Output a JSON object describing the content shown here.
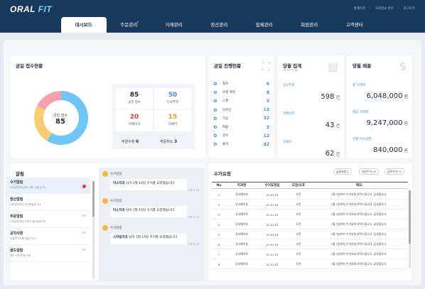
{
  "header": {
    "logo_a": "ORAL ",
    "logo_b": "FIT",
    "links": [
      "홈페이지",
      "|",
      "치과정보 관리",
      "|",
      "로그아웃"
    ],
    "tabs": [
      {
        "label": "대시보드",
        "active": true
      },
      {
        "label": "주문관리",
        "active": false,
        "dot": true
      },
      {
        "label": "자재관리"
      },
      {
        "label": "정산관리"
      },
      {
        "label": "업체관리"
      },
      {
        "label": "회원관리"
      },
      {
        "label": "고객센터"
      }
    ]
  },
  "status": {
    "title": "금일 접수현황",
    "center_label": "금일 접수",
    "center_value": "85",
    "donut": [
      {
        "value": 50,
        "color": "#6fc6f7"
      },
      {
        "value": 20,
        "color": "#f7cd6f"
      },
      {
        "value": 15,
        "color": "#f7a0b0"
      }
    ],
    "stats": [
      {
        "num": "85",
        "label": "금일 접수",
        "color": "#1e2d3d"
      },
      {
        "num": "50",
        "label": "신규주문",
        "color": "#3a8ee6"
      },
      {
        "num": "20",
        "label": "리메이크",
        "color": "#e33b3b"
      },
      {
        "num": "15",
        "label": "리페어",
        "color": "#f09a1f"
      }
    ],
    "order_edit_label": "주문수정",
    "order_edit_value": "6",
    "order_cancel_label": "주문취소",
    "order_cancel_value": "3"
  },
  "progress": {
    "title": "금일 진행현황",
    "items": [
      {
        "name": "접수",
        "value": "6"
      },
      {
        "name": "모델 제작",
        "value": "8"
      },
      {
        "name": "스캔",
        "value": "3"
      },
      {
        "name": "디자인",
        "value": "12"
      },
      {
        "name": "가공",
        "value": "32"
      },
      {
        "name": "작업",
        "value": "3"
      },
      {
        "name": "검수",
        "value": "12"
      },
      {
        "name": "출하",
        "value": "32"
      }
    ]
  },
  "settle": {
    "title": "당월 집계",
    "sub": "(총 675건 중)",
    "rows": [
      {
        "label": "신규주문",
        "value": "598",
        "unit": "건"
      },
      {
        "label": "리메이크",
        "value": "43",
        "unit": "건"
      },
      {
        "label": "리페어",
        "value": "62",
        "unit": "건"
      }
    ]
  },
  "sales": {
    "title": "당월 매출",
    "rows": [
      {
        "label": "총 거래액",
        "value": "6,048,000",
        "unit": "원"
      },
      {
        "label": "평균 거래액",
        "value": "9,247,000",
        "unit": "원"
      },
      {
        "label": "전월 미수금액",
        "value": "840,000",
        "unit": "원"
      }
    ]
  },
  "alarm": {
    "title": "알림",
    "items": [
      {
        "title": "수거알림",
        "sub": "스마일치과님께서 1월 14일 수거...",
        "time": "",
        "badge": true,
        "selected": true
      },
      {
        "title": "정산알림",
        "sub": "스마일치과님 정산예정입니다.",
        "time": ""
      },
      {
        "title": "주문알림",
        "sub": "스마일치과님 주문이 들어왔습니다.",
        "time": "오후"
      },
      {
        "title": "공지사항",
        "sub": "오랄핏 시스템 점검 안내",
        "time": "오후"
      },
      {
        "title": "골드알림",
        "sub": "골드 시세 변동 안내",
        "time": "오후"
      }
    ],
    "chats": [
      {
        "who": "수거알림",
        "name": "미소치과",
        "text": " 님이 1월 14일 수거를 요청했습니다.",
        "time": "오후 3:24"
      },
      {
        "who": "수거알림",
        "name": "미소치과",
        "text": " 님이 1월 16일 수거를 요청했습니다.",
        "time": "오후 3:24"
      },
      {
        "who": "수거알림",
        "name": "스마일치과",
        "text": " 님이 1월 14일 수거를 요청했습니다.",
        "time": "오후 3:24"
      }
    ]
  },
  "requests": {
    "title": "수거요청",
    "pills": [
      {
        "label": "금일요청",
        "value": "8"
      },
      {
        "label": "요청수거",
        "value": "26"
      },
      {
        "label": "금주수거",
        "value": "35"
      }
    ],
    "columns": [
      "No",
      "치과명",
      "수거요청일",
      "오전/오후",
      "메모"
    ],
    "rows": [
      [
        "1",
        "강서예치과",
        "22.01.03",
        "오전",
        "1월 3일까지 수거요청 부탁드립니다. 감사합니다."
      ],
      [
        "2",
        "강서예치과",
        "22.01.03",
        "오전",
        "1월 3일까지 수거요청 부탁드립니다. 감사합니다."
      ],
      [
        "3",
        "강서예치과",
        "22.01.03",
        "오전",
        "1월 3일까지 수거요청 부탁드립니다. 감사합니다."
      ],
      [
        "4",
        "강서예치과",
        "22.01.03",
        "오전",
        "1월 3일까지 수거요청 부탁드립니다. 감사합니다."
      ],
      [
        "5",
        "강서예치과",
        "22.01.03",
        "오전",
        "1월 3일까지 수거요청 부탁드립니다. 감사합니다."
      ],
      [
        "6",
        "강서예치과",
        "22.01.03",
        "오전",
        "1월 3일까지 수거요청 부탁드립니다. 감사합니다."
      ],
      [
        "7",
        "강서예치과",
        "22.01.03",
        "오전",
        "1월 3일까지 수거요청 부탁드립니다. 감사합니다."
      ],
      [
        "8",
        "강서예치과",
        "22.01.03",
        "오전",
        "1월 3일까지 수거요청 부탁드립니다. 감사합니다."
      ]
    ]
  }
}
